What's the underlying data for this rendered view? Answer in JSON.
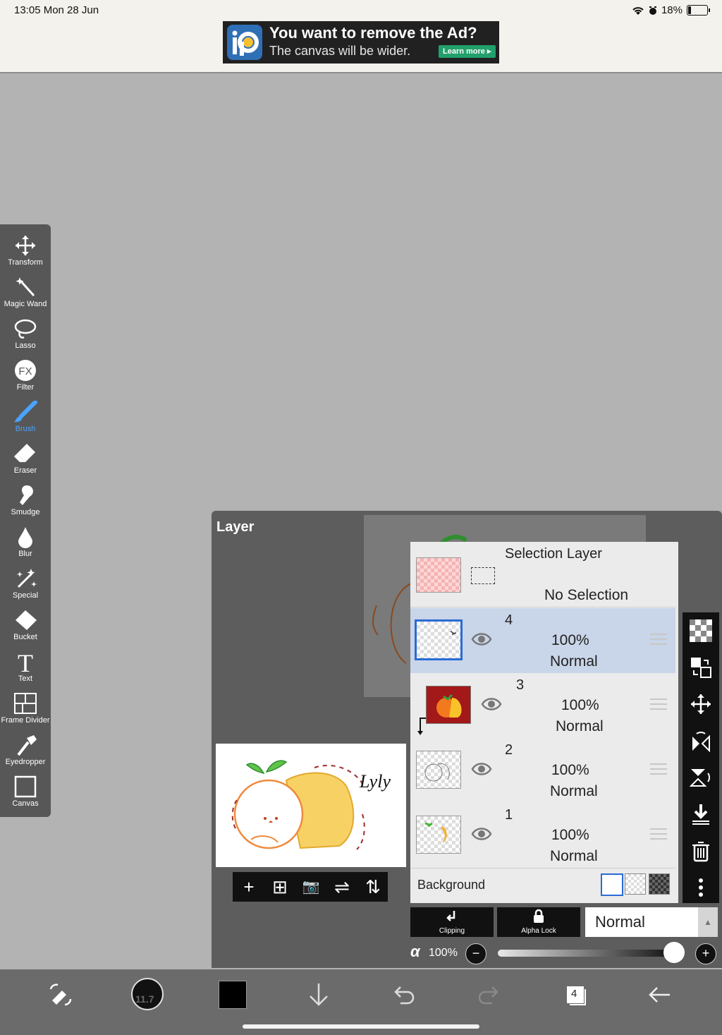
{
  "status_bar": {
    "time_date": "13:05  Mon 28 Jun",
    "battery_pct": "18%",
    "battery_level": 0.18
  },
  "ad": {
    "title": "You want to remove the Ad?",
    "subtitle": "The canvas will be wider.",
    "cta": "Learn more ▸"
  },
  "toolbar": {
    "active": "Brush",
    "tools": [
      {
        "label": "Transform",
        "icon": "move-icon"
      },
      {
        "label": "Magic Wand",
        "icon": "magic-wand-icon"
      },
      {
        "label": "Lasso",
        "icon": "lasso-icon"
      },
      {
        "label": "Filter",
        "icon": "fx-filter-icon",
        "glyph": "FX"
      },
      {
        "label": "Brush",
        "icon": "brush-icon"
      },
      {
        "label": "Eraser",
        "icon": "eraser-icon"
      },
      {
        "label": "Smudge",
        "icon": "smudge-icon"
      },
      {
        "label": "Blur",
        "icon": "blur-drop-icon"
      },
      {
        "label": "Special",
        "icon": "special-sparkle-icon"
      },
      {
        "label": "Bucket",
        "icon": "bucket-icon"
      },
      {
        "label": "Text",
        "icon": "text-icon",
        "glyph": "T"
      },
      {
        "label": "Frame Divider",
        "icon": "frame-divider-icon"
      },
      {
        "label": "Eyedropper",
        "icon": "eyedropper-icon"
      },
      {
        "label": "Canvas",
        "icon": "canvas-icon"
      }
    ]
  },
  "layer_panel": {
    "title": "Layer",
    "thumbnail_signature": "Lyly",
    "actions": [
      {
        "glyph": "+",
        "icon": "add-layer-icon"
      },
      {
        "glyph": "⊞",
        "icon": "add-layer-box-icon"
      },
      {
        "glyph": "📷",
        "icon": "camera-icon"
      },
      {
        "glyph": "⇌",
        "icon": "flip-horizontal-icon"
      },
      {
        "glyph": "⇅",
        "icon": "flip-vertical-icon"
      }
    ],
    "selection_layer": {
      "title": "Selection Layer",
      "status": "No Selection"
    },
    "layers": [
      {
        "number": "4",
        "opacity": "100%",
        "mode": "Normal",
        "selected": true
      },
      {
        "number": "3",
        "opacity": "100%",
        "mode": "Normal",
        "selected": false,
        "clipped": true
      },
      {
        "number": "2",
        "opacity": "100%",
        "mode": "Normal",
        "selected": false
      },
      {
        "number": "1",
        "opacity": "100%",
        "mode": "Normal",
        "selected": false
      }
    ],
    "background_label": "Background",
    "side_tools": [
      "checker-icon",
      "layer-move-icon",
      "move-icon",
      "flip-horizontal-icon",
      "flip-vertical-icon",
      "merge-down-icon",
      "trash-icon",
      "more-icon"
    ],
    "clipping_label": "Clipping",
    "alpha_lock_label": "Alpha Lock",
    "blend_mode": "Normal",
    "alpha_symbol": "α",
    "alpha_value": "100%",
    "alpha_level": 1.0
  },
  "bottom_bar": {
    "brush_size": "11.7",
    "layers_count": "4",
    "icons": [
      "transform-swap-icon",
      "brush-size-icon",
      "color-swatch-icon",
      "down-arrow-icon",
      "undo-icon",
      "redo-icon",
      "layers-icon",
      "back-icon"
    ]
  },
  "colors": {
    "accent_blue": "#4aa3ff",
    "primary_color": "#000000",
    "selected_row": "#c9d5e8"
  }
}
